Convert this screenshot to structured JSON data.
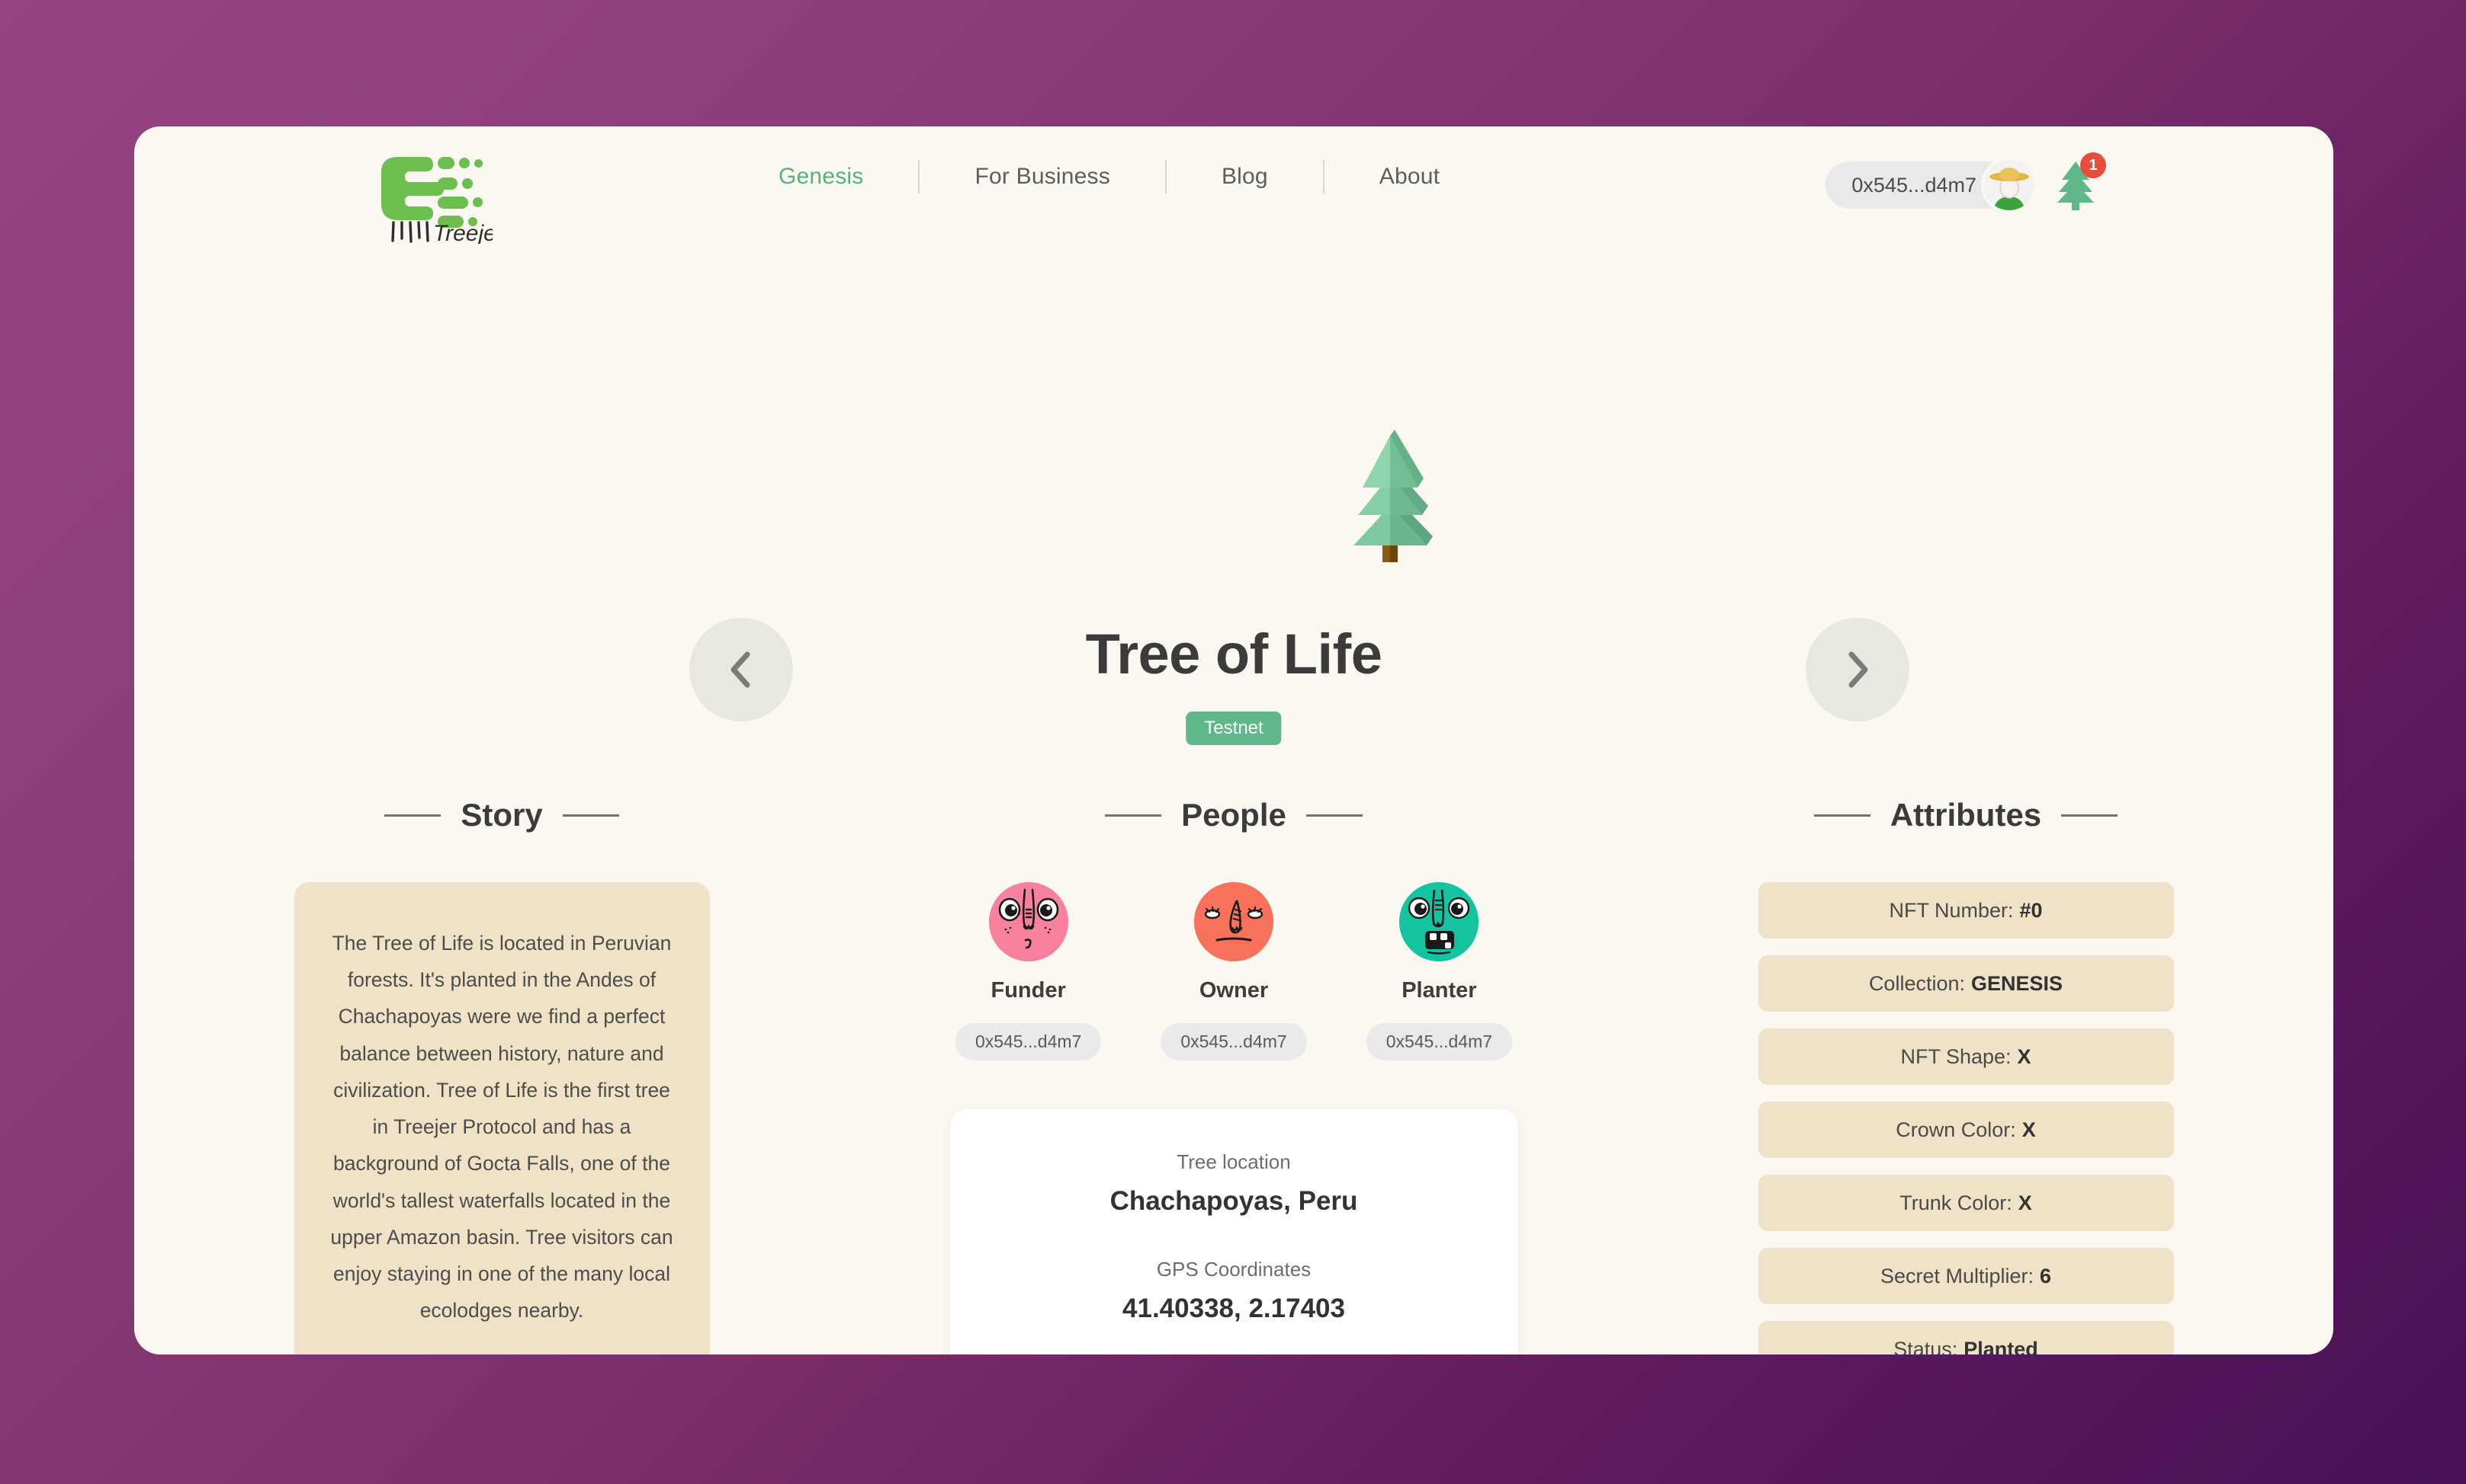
{
  "theme": {
    "bg_gradient_start": "#974481",
    "bg_gradient_end": "#491157",
    "panel_bg": "#fbf8f1",
    "card_tan": "#efe2c7",
    "accent_green": "#55b375",
    "badge_green": "#5fb889",
    "notif_red": "#e74c3c"
  },
  "header": {
    "logo_name": "treejer-logo",
    "logo_wordmark": "Treejer",
    "nav": [
      {
        "label": "Genesis",
        "active": true
      },
      {
        "label": "For Business",
        "active": false
      },
      {
        "label": "Blog",
        "active": false
      },
      {
        "label": "About",
        "active": false
      }
    ],
    "wallet": {
      "address": "0x545...d4m7",
      "avatar_name": "farmer-avatar"
    },
    "notification": {
      "icon": "tree-icon",
      "count": "1"
    }
  },
  "hero": {
    "tree_illustration": "pine-tree-3d",
    "title": "Tree of Life",
    "badge": "Testnet",
    "prev_label": "chevron-left-icon",
    "next_label": "chevron-right-icon"
  },
  "story": {
    "heading": "Story",
    "text": "The Tree of Life is located in Peruvian forests. It's planted in the Andes of Chachapoyas were we find a perfect balance between history, nature and civilization. Tree of Life is the first tree in Treejer Protocol and has a background of Gocta Falls, one of the world's tallest waterfalls located in the upper Amazon basin. Tree visitors can enjoy staying in one of the many local ecolodges nearby."
  },
  "people": {
    "heading": "People",
    "members": [
      {
        "role": "Funder",
        "address": "0x545...d4m7",
        "face_color": "#f8819e",
        "face_name": "funder-face-avatar"
      },
      {
        "role": "Owner",
        "address": "0x545...d4m7",
        "face_color": "#f8715a",
        "face_name": "owner-face-avatar"
      },
      {
        "role": "Planter",
        "address": "0x545...d4m7",
        "face_color": "#14c4a0",
        "face_name": "planter-face-avatar"
      }
    ],
    "location": {
      "location_label": "Tree location",
      "location_value": "Chachapoyas, Peru",
      "gps_label": "GPS Coordinates",
      "gps_value": "41.40338, 2.17403"
    }
  },
  "attributes": {
    "heading": "Attributes",
    "rows": [
      {
        "label": "NFT Number:",
        "value": "#0"
      },
      {
        "label": "Collection:",
        "value": "GENESIS"
      },
      {
        "label": "NFT Shape:",
        "value": "X"
      },
      {
        "label": "Crown Color:",
        "value": "X"
      },
      {
        "label": "Trunk Color:",
        "value": "X"
      },
      {
        "label": "Secret Multiplier:",
        "value": "6"
      },
      {
        "label": "Status:",
        "value": "Planted"
      }
    ]
  }
}
